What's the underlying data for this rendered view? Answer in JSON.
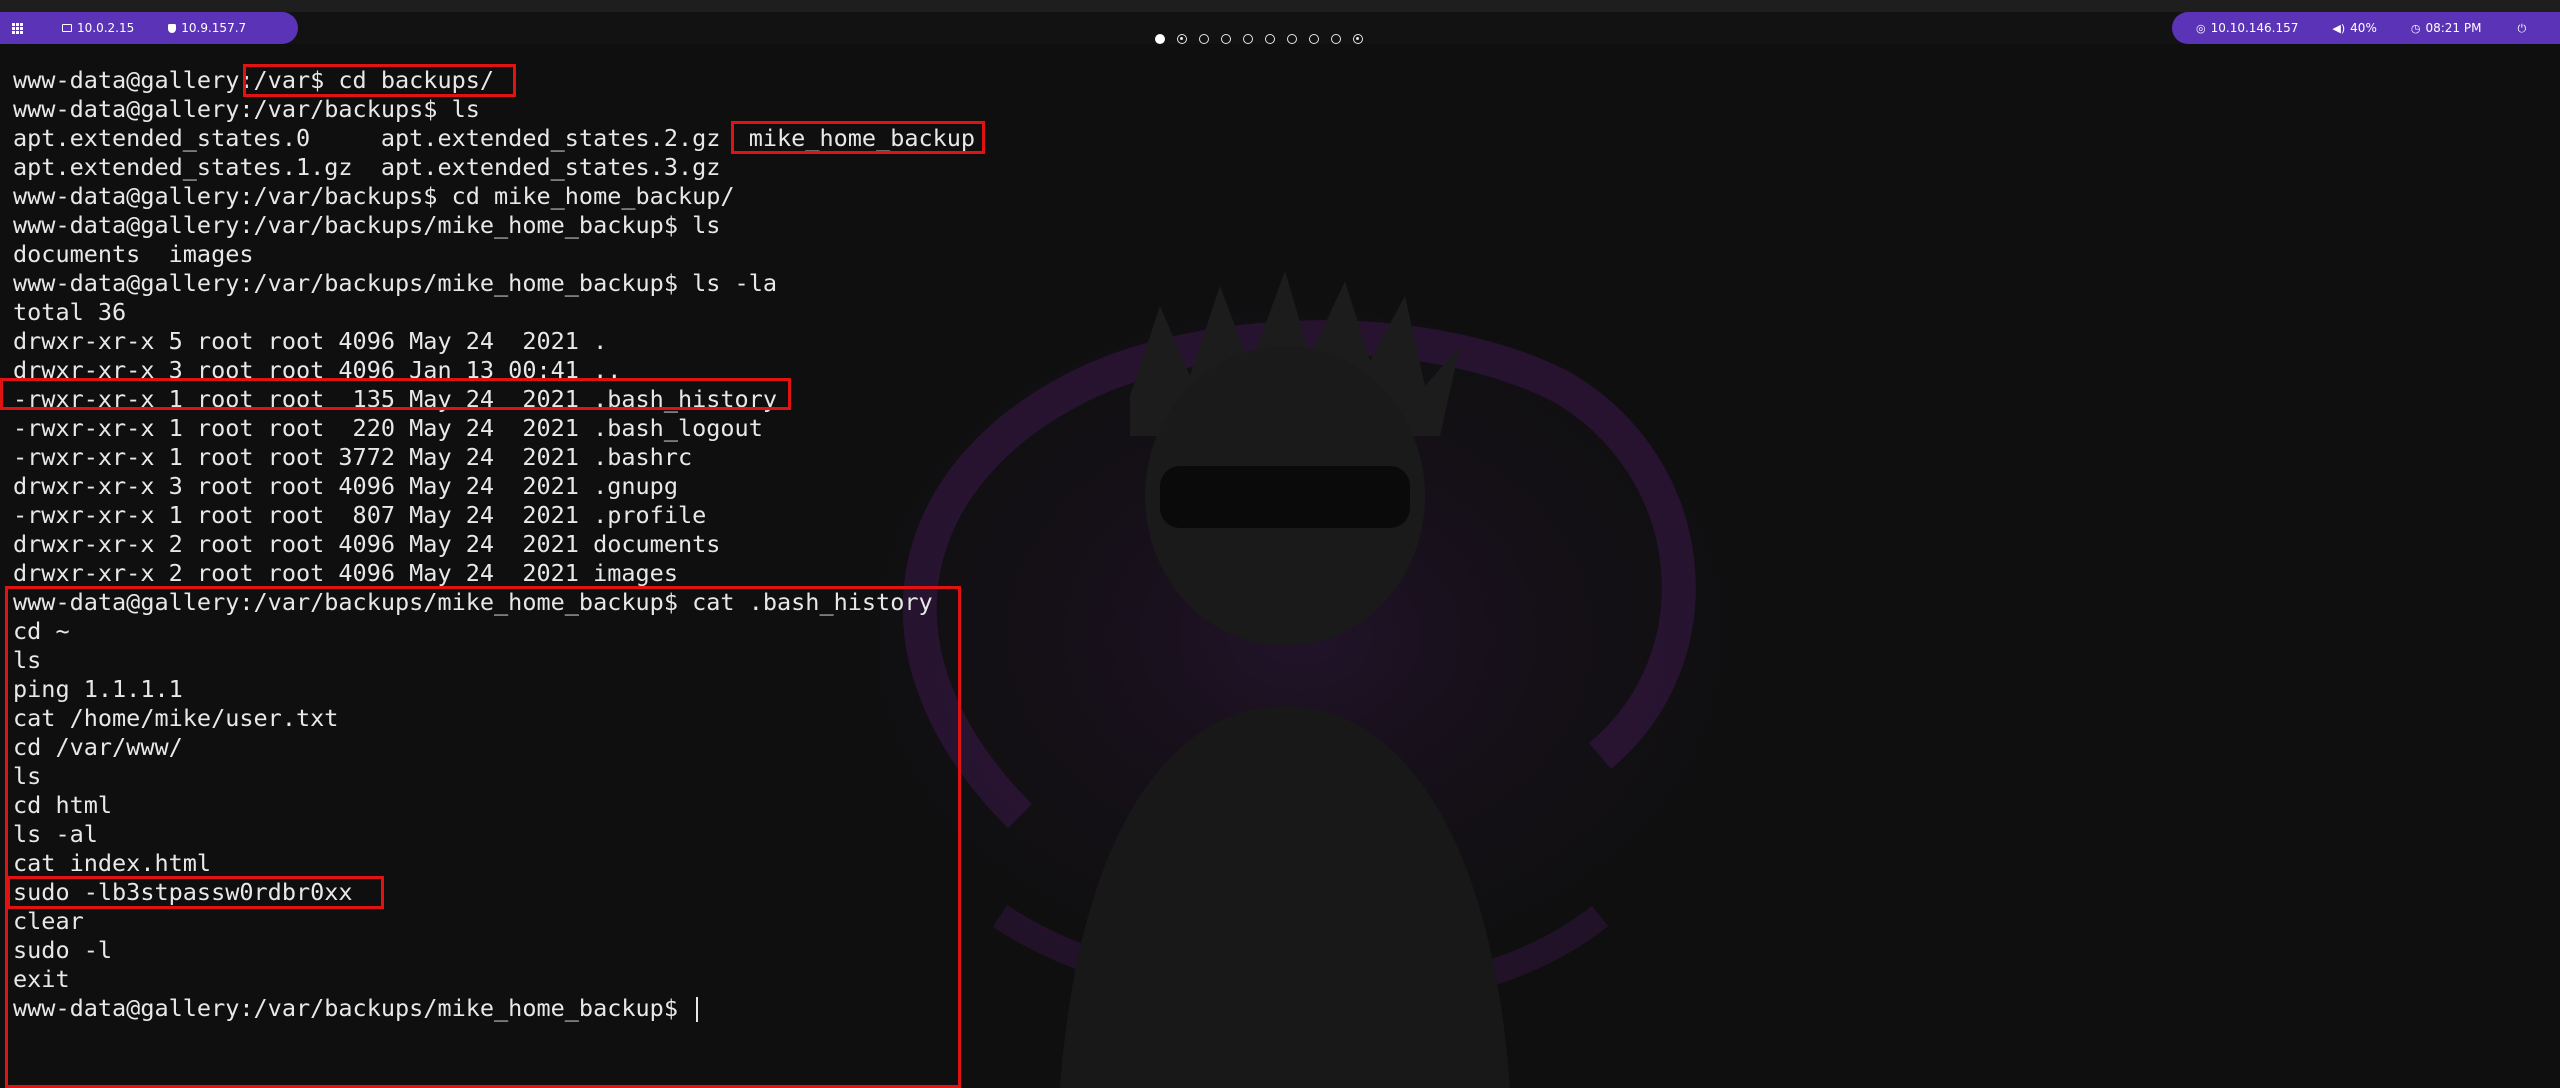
{
  "taskbar": {
    "left": {
      "apps_icon": "grid-icon",
      "ip_local": "10.0.2.15",
      "ip_vpn": "10.9.157.7"
    },
    "workspaces": [
      {
        "state": "active"
      },
      {
        "state": "dot"
      },
      {
        "state": "empty"
      },
      {
        "state": "empty"
      },
      {
        "state": "empty"
      },
      {
        "state": "empty"
      },
      {
        "state": "empty"
      },
      {
        "state": "empty"
      },
      {
        "state": "empty"
      },
      {
        "state": "dot"
      }
    ],
    "right": {
      "target_ip": "10.10.146.157",
      "volume": "40%",
      "clock": "08:21 PM",
      "power_icon": "power-icon"
    }
  },
  "terminal": {
    "lines": [
      "www-data@gallery:/var$ cd backups/",
      "www-data@gallery:/var/backups$ ls",
      "apt.extended_states.0     apt.extended_states.2.gz  mike_home_backup",
      "apt.extended_states.1.gz  apt.extended_states.3.gz",
      "www-data@gallery:/var/backups$ cd mike_home_backup/",
      "www-data@gallery:/var/backups/mike_home_backup$ ls",
      "documents  images",
      "www-data@gallery:/var/backups/mike_home_backup$ ls -la",
      "total 36",
      "drwxr-xr-x 5 root root 4096 May 24  2021 .",
      "drwxr-xr-x 3 root root 4096 Jan 13 00:41 ..",
      "-rwxr-xr-x 1 root root  135 May 24  2021 .bash_history",
      "-rwxr-xr-x 1 root root  220 May 24  2021 .bash_logout",
      "-rwxr-xr-x 1 root root 3772 May 24  2021 .bashrc",
      "drwxr-xr-x 3 root root 4096 May 24  2021 .gnupg",
      "-rwxr-xr-x 1 root root  807 May 24  2021 .profile",
      "drwxr-xr-x 2 root root 4096 May 24  2021 documents",
      "drwxr-xr-x 2 root root 4096 May 24  2021 images",
      "www-data@gallery:/var/backups/mike_home_backup$ cat .bash_history",
      "cd ~",
      "ls",
      "ping 1.1.1.1",
      "cat /home/mike/user.txt",
      "cd /var/www/",
      "ls",
      "cd html",
      "ls -al",
      "cat index.html",
      "sudo -lb3stpassw0rdbr0xx",
      "clear",
      "sudo -l",
      "exit",
      "www-data@gallery:/var/backups/mike_home_backup$ "
    ],
    "text_color": "#e8e8e8",
    "background": "#0f0f0f",
    "highlight_color": "#e01212"
  }
}
